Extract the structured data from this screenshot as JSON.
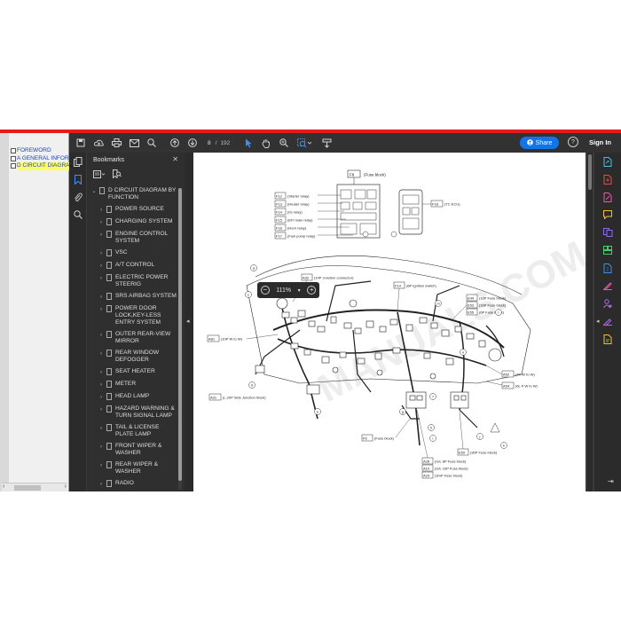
{
  "legacy_tree": {
    "items": [
      {
        "label": "FOREWORD",
        "selected": false
      },
      {
        "label": "A GENERAL INFORM",
        "selected": false
      },
      {
        "label": "D CIRCUIT DIAGRAM",
        "selected": true
      }
    ]
  },
  "toolbar": {
    "page_current": "8",
    "page_sep": "/",
    "page_total": "192",
    "share_label": "Share",
    "signin_label": "Sign In",
    "help_label": "?"
  },
  "zoom": {
    "value": "111%",
    "minus": "−",
    "plus": "+",
    "caret": "▾"
  },
  "bookmarks": {
    "title": "Bookmarks",
    "root": "D CIRCUIT DIAGRAM BY FUNCTION",
    "items": [
      "POWER SOURCE",
      "CHARGING SYSTEM",
      "ENGINE CONTROL SYSTEM",
      "VSC",
      "A/T CONTROL",
      "ELECTRIC POWER STEERIG",
      "SRS AIRBAG SYSTEM",
      "POWER DOOR LOCK,KEY-LESS ENTRY SYSTEM",
      "OUTER REAR-VIEW MIRROR",
      "REAR WINDOW DEFOGGER",
      "SEAT HEATER",
      "METER",
      "HEAD LAMP",
      "HAZARD WARNING & TURN SIGNAL LAMP",
      "TAIL & LICENSE PLATE LAMP",
      "FRONT WIPER & WASHER",
      "REAR WIPER & WASHER",
      "RADIO"
    ]
  },
  "diagram": {
    "fuse_block_top": {
      "code": "F8",
      "text": "(Fuse block)"
    },
    "relays": [
      {
        "code": "F12",
        "text": "(Starter relay)"
      },
      {
        "code": "F13",
        "text": "(Heater relay)"
      },
      {
        "code": "F14",
        "text": "(IG relay)"
      },
      {
        "code": "F15",
        "text": "(EFI main relay)"
      },
      {
        "code": "F16",
        "text": "(Horn relay)"
      },
      {
        "code": "F17",
        "text": "(Fuel pump relay)"
      }
    ],
    "tc_ecu": {
      "code": "F18",
      "text": "(TC ECU)"
    },
    "junction": {
      "code": "A32",
      "text": "(14P Junction connector)"
    },
    "ign_switch": {
      "code": "F14",
      "text": "(6P Ignition switch)"
    },
    "right_fuses": [
      {
        "code": "E44",
        "text": "(16P Fuse block)"
      },
      {
        "code": "E53",
        "text": "(16P Fuse block)"
      },
      {
        "code": "E55",
        "text": "(6P Fuse block)"
      }
    ],
    "left_wire": {
      "code": "A81",
      "text": "(10P W to W)"
    },
    "right_w1": {
      "code": "A52",
      "text": "(4P W to W)"
    },
    "right_w2": {
      "code": "A54",
      "text": "(6L P W to W)"
    },
    "side_junction": {
      "code": "A31",
      "text": "(L.20P Side Junction block)"
    },
    "fuse_block_bottom": {
      "code": "F6",
      "text": "(Fuse block)"
    },
    "bottom_right": {
      "code": "E50",
      "text": "(30P Fuse block)"
    },
    "bottom_list": [
      {
        "code": "A28",
        "text": "(G/L 8P Fuse block)"
      },
      {
        "code": "A10",
        "text": "(G/L 10P Fuse block)"
      },
      {
        "code": "A29",
        "text": "(3mP Fuse block)"
      }
    ],
    "callouts": [
      "a",
      "b",
      "c",
      "d",
      "e",
      "f",
      "g",
      "h",
      "i",
      "j",
      "k",
      "l",
      "m",
      "n"
    ]
  },
  "colors": {
    "accent": "#1473e6",
    "brand_red": "#e8191c",
    "highlight": "#ffff66",
    "link_blue": "#1a3fbf"
  },
  "icons": {
    "rail_left": [
      "copy-icon",
      "bookmark-icon",
      "attachment-icon",
      "search-icon"
    ],
    "rail_right": [
      "export-pdf-icon",
      "create-pdf-icon",
      "edit-pdf-icon",
      "comment-icon",
      "combine-icon",
      "organize-icon",
      "compress-icon",
      "redact-icon",
      "protect-icon",
      "fill-sign-icon",
      "more-tools-icon"
    ]
  }
}
